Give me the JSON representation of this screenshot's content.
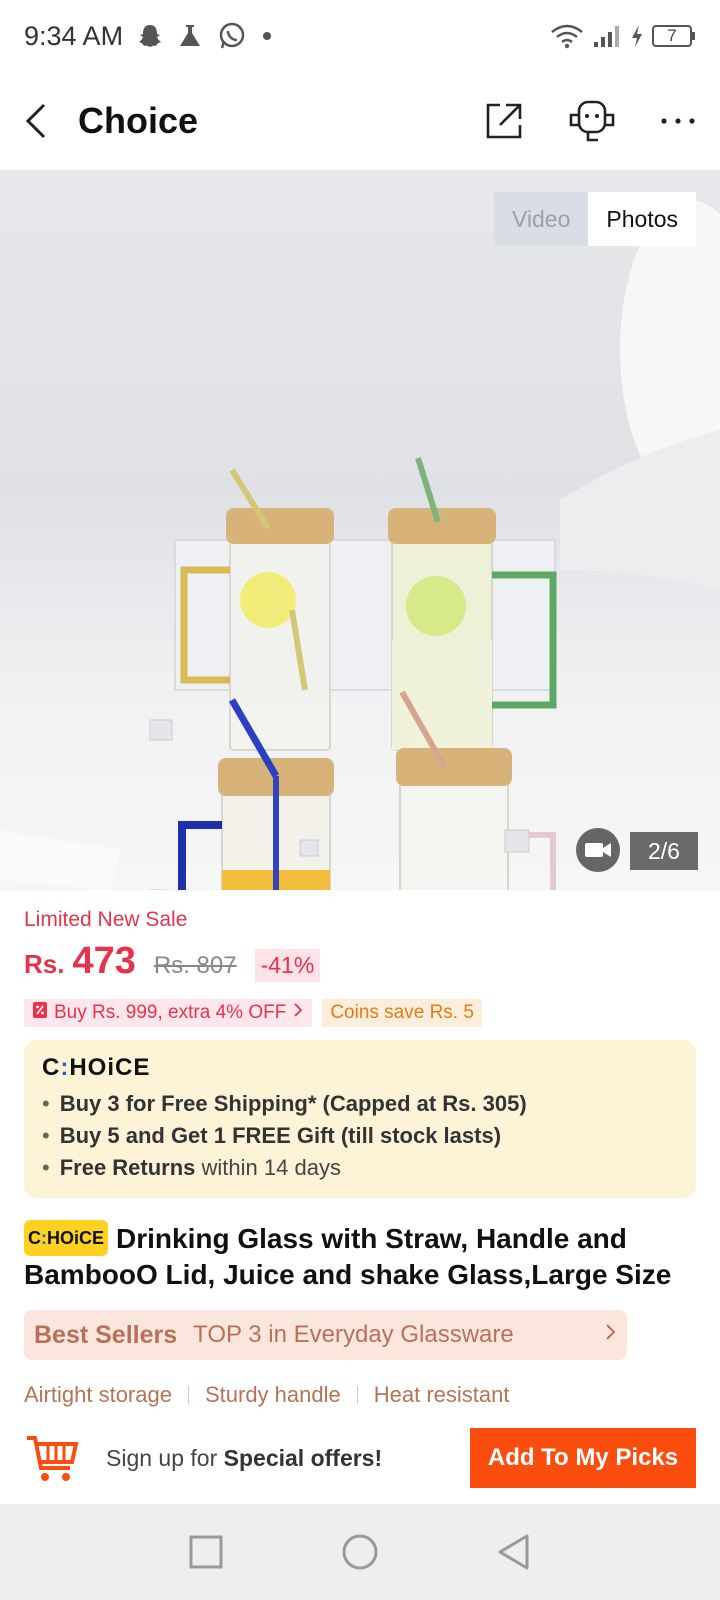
{
  "status_bar": {
    "time": "9:34 AM",
    "battery": "7"
  },
  "header": {
    "title": "Choice"
  },
  "gallery": {
    "toggle_video": "Video",
    "toggle_photos": "Photos",
    "counter": "2/6"
  },
  "price": {
    "limited_label": "Limited New Sale",
    "currency": "Rs.",
    "current": "473",
    "original": "Rs. 807",
    "discount": "-41%",
    "promo_1": "Buy Rs. 999, extra 4% OFF",
    "promo_2": "Coins save Rs. 5"
  },
  "choice_box": {
    "logo_pre": "C",
    "logo_dot": ":",
    "logo_post": "HOiCE",
    "item_1": "Buy 3 for  Free Shipping* (Capped at Rs. 305)",
    "item_2": "Buy 5 and Get 1 FREE Gift (till stock lasts)",
    "item_3_bold": "Free Returns",
    "item_3_rest": " within 14 days"
  },
  "product": {
    "badge_pre": "C",
    "badge_dot": ":",
    "badge_post": "HOiCE",
    "title": "Drinking Glass with Straw, Handle and BambooO Lid, Juice and shake Glass,Large Size"
  },
  "best_sellers": {
    "label": "Best Sellers",
    "text": "TOP 3 in Everyday Glassware"
  },
  "features": [
    "Airtight storage",
    "Sturdy handle",
    "Heat resistant"
  ],
  "bottom_bar": {
    "signup_pre": "Sign up for ",
    "signup_bold": "Special offers!",
    "picks_button": "Add To My Picks"
  },
  "colors": {
    "accent": "#fb4d0e",
    "price_red": "#e8324c",
    "choice_bg": "#fdf3d7"
  },
  "icons": [
    "back-arrow-icon",
    "share-icon",
    "customer-service-icon",
    "more-icon",
    "video-camera-icon",
    "coupon-icon",
    "cart-icon",
    "recents-icon",
    "home-icon",
    "back-icon"
  ]
}
